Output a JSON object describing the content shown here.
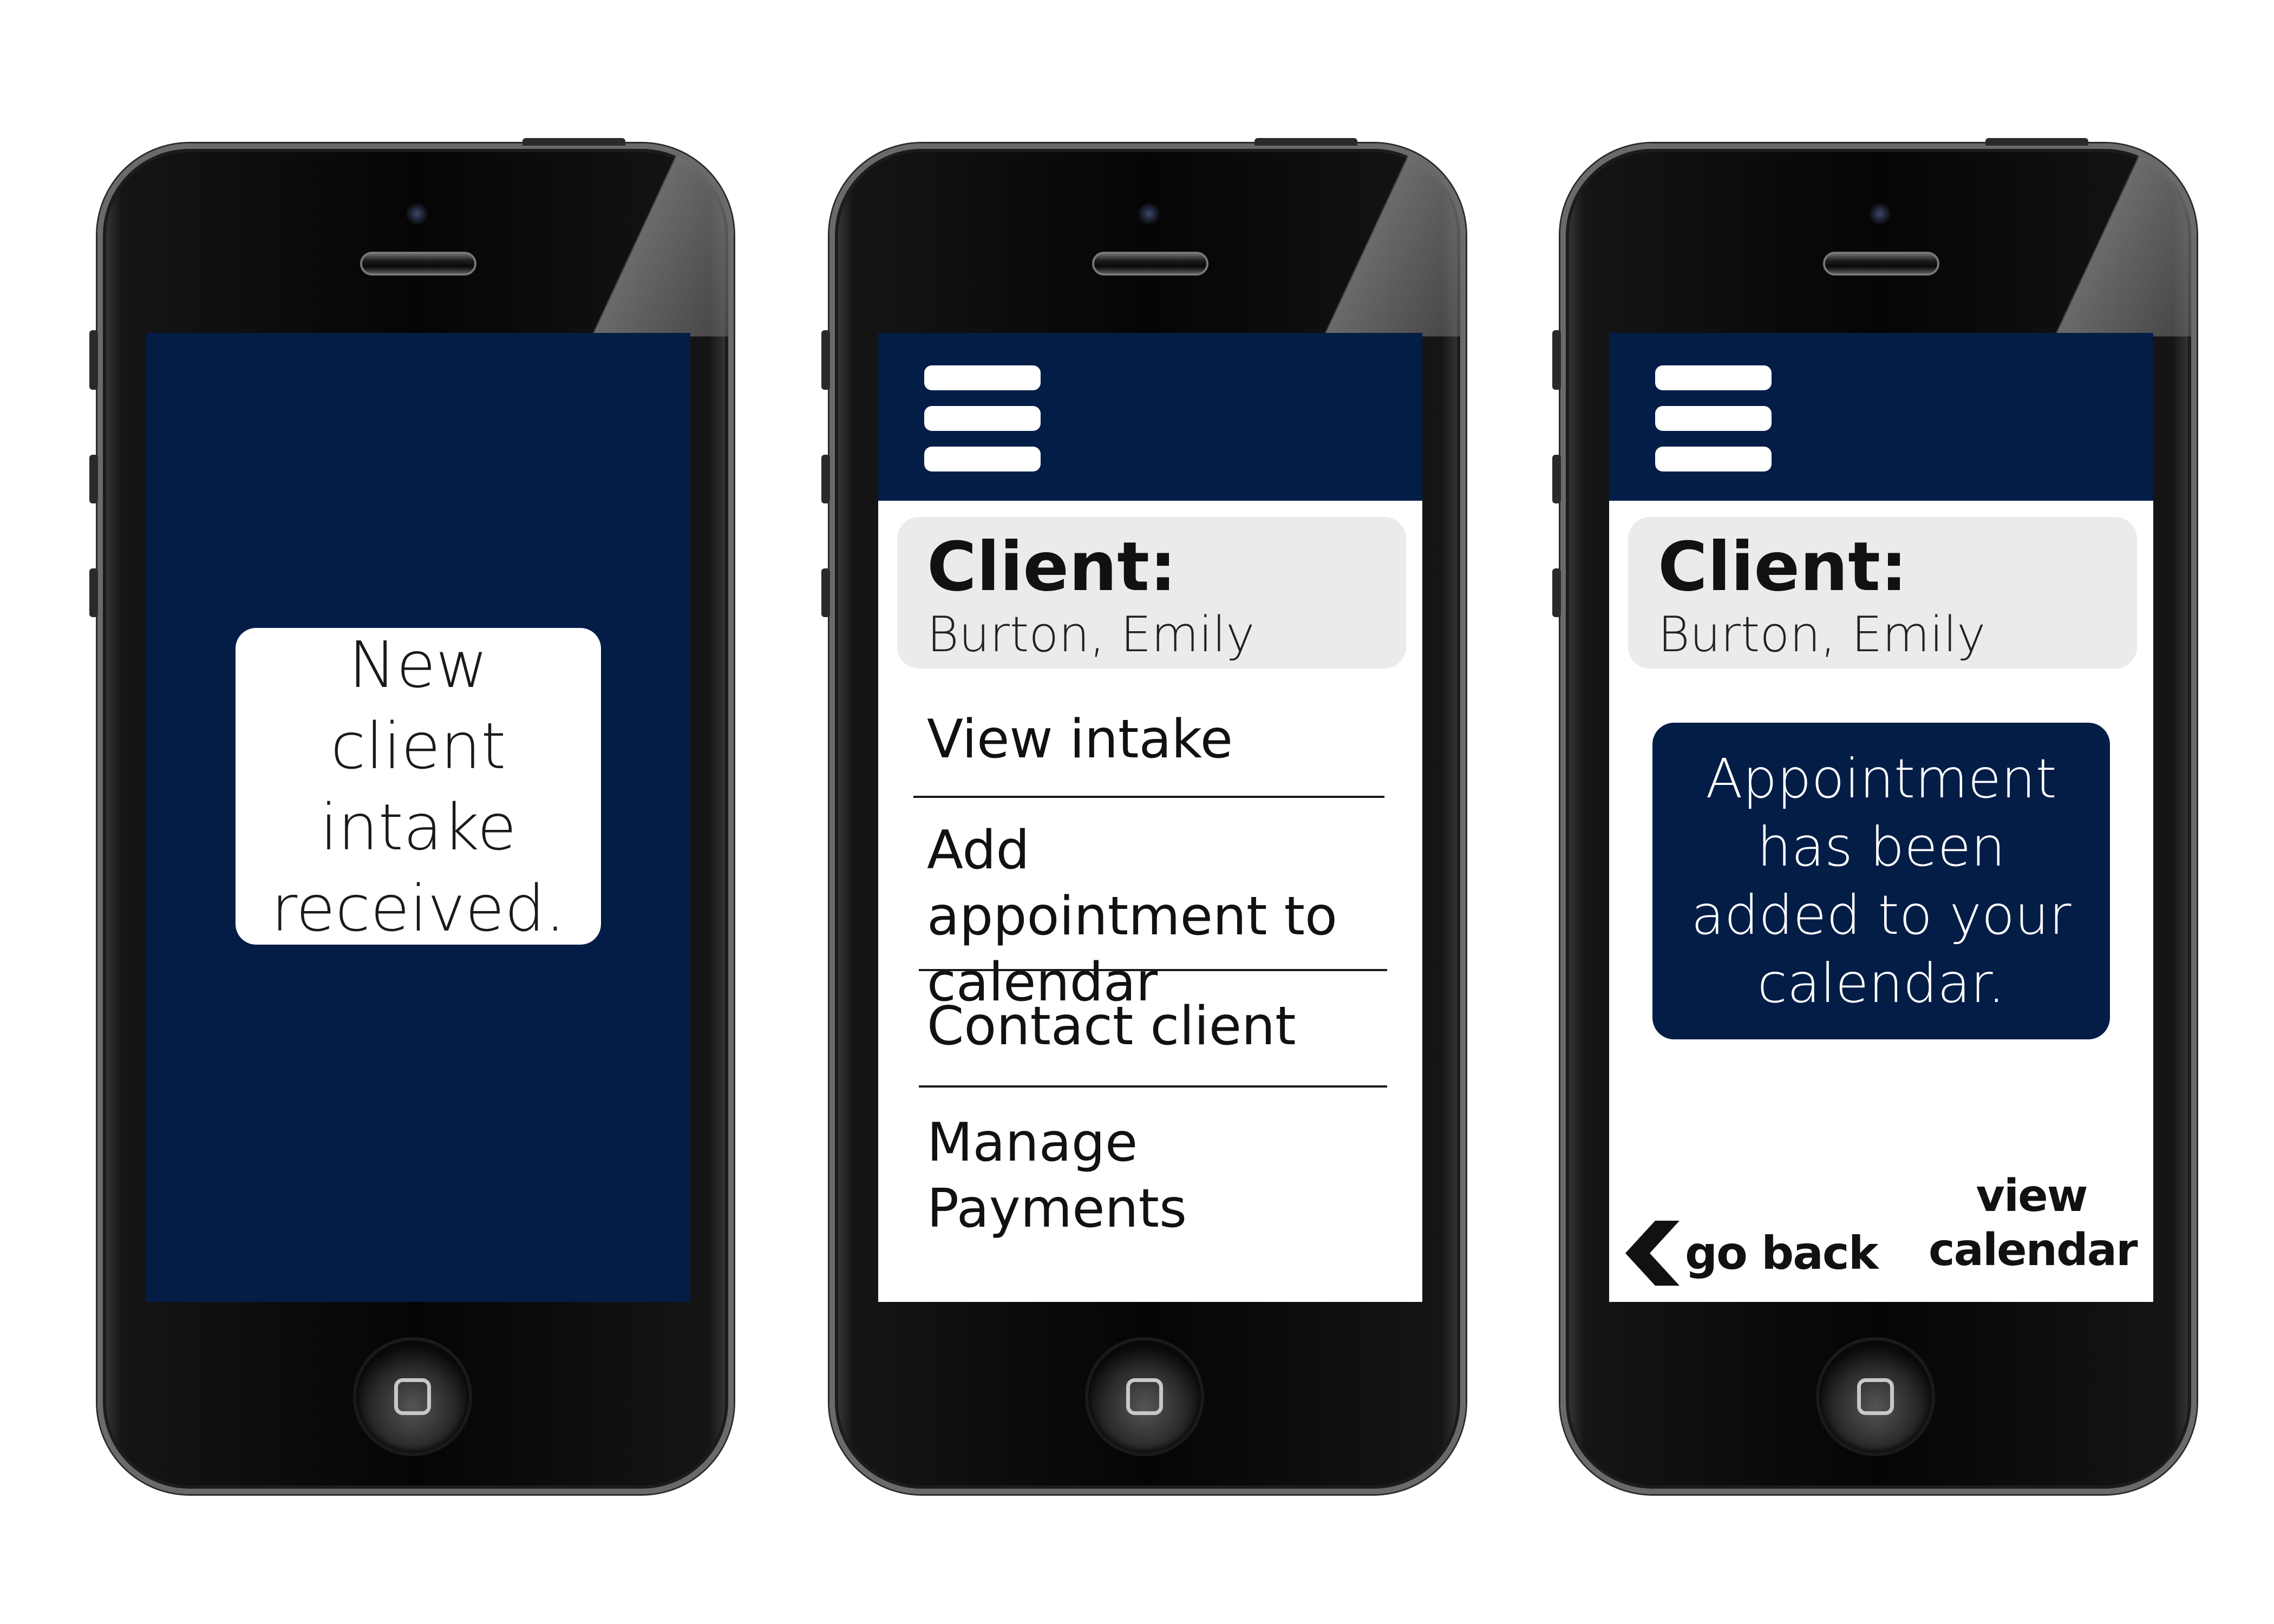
{
  "colors": {
    "brand_navy": "#041d47",
    "card_gray": "#ebebeb",
    "phone_black": "#050505"
  },
  "screen1": {
    "notification_text": "New client intake received."
  },
  "screen2": {
    "menu_icon": "hamburger-icon",
    "client_label": "Client:",
    "client_name": "Burton, Emily",
    "menu_items": [
      {
        "label": "View intake"
      },
      {
        "label": "Add appointment to calendar"
      },
      {
        "label": "Contact client"
      },
      {
        "label": "Manage Payments"
      }
    ]
  },
  "screen3": {
    "menu_icon": "hamburger-icon",
    "client_label": "Client:",
    "client_name": "Burton, Emily",
    "confirmation_text": "Appointment has been added to your calendar.",
    "back_icon": "chevron-left-icon",
    "back_label": "go back",
    "view_calendar_label": "view calendar"
  }
}
